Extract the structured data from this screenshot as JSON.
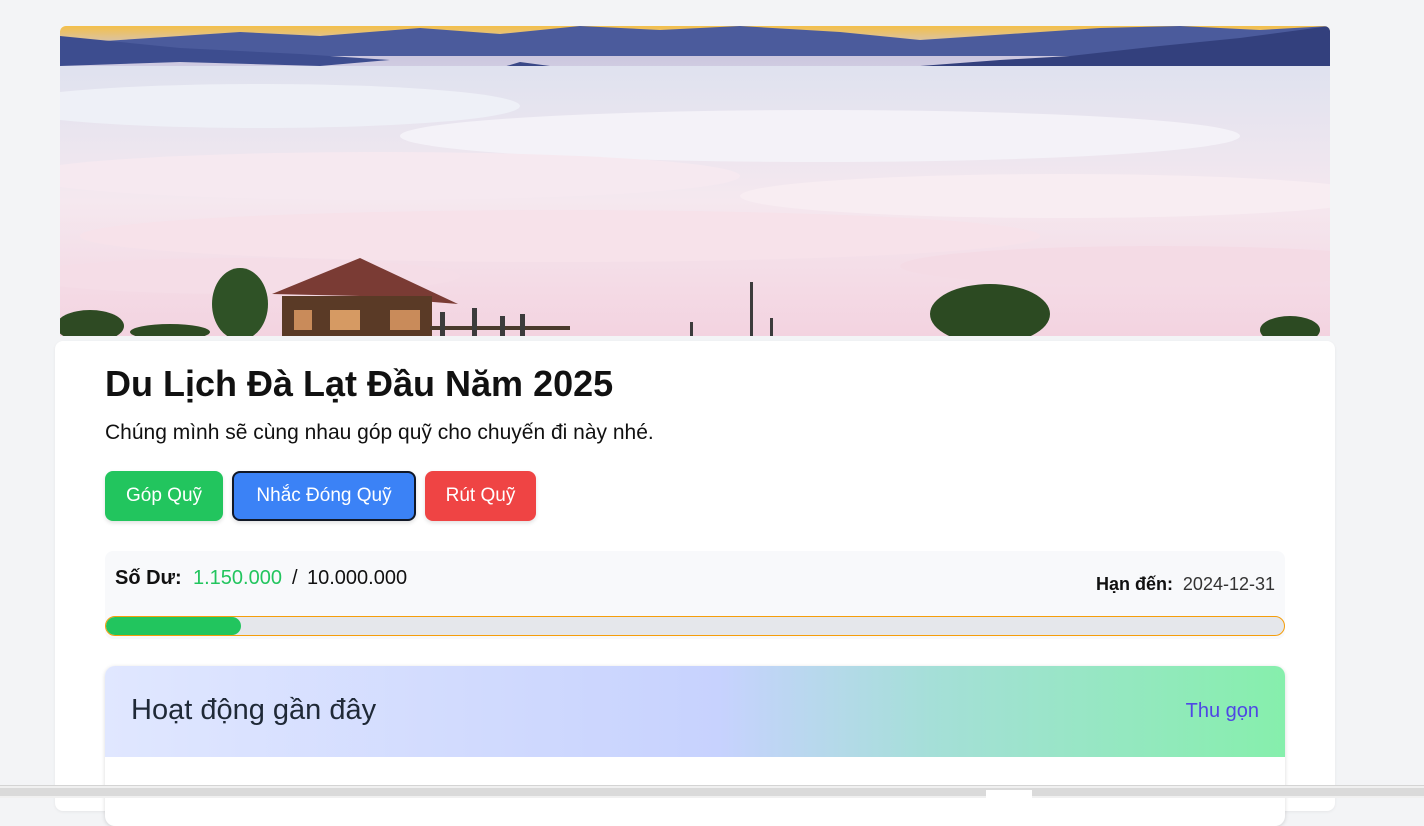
{
  "fund": {
    "title": "Du Lịch Đà Lạt Đầu Năm 2025",
    "description": "Chúng mình sẽ cùng nhau góp quỹ cho chuyến đi này nhé."
  },
  "actions": {
    "contribute_label": "Góp Quỹ",
    "remind_label": "Nhắc Đóng Quỹ",
    "withdraw_label": "Rút Quỹ"
  },
  "balance": {
    "label": "Số Dư:",
    "current": "1.150.000",
    "separator": "/",
    "target": "10.000.000",
    "progress_fraction": 0.115
  },
  "deadline": {
    "label": "Hạn đến:",
    "value": "2024-12-31"
  },
  "activity": {
    "title": "Hoạt động gần đây",
    "collapse_label": "Thu gọn"
  },
  "colors": {
    "contribute": "#22c55e",
    "remind": "#3b82f6",
    "withdraw": "#ef4444",
    "balance_current": "#22c55e",
    "progress_border": "#f59e0b",
    "collapse_link": "#4f46e5"
  },
  "hero_image": {
    "subject": "mountain-sea-of-clouds-landscape"
  }
}
